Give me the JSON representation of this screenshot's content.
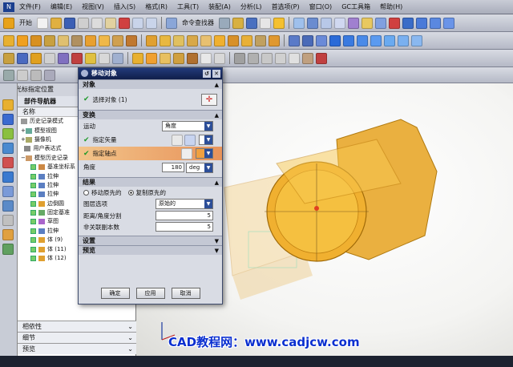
{
  "menubar": {
    "items": [
      "文件(F)",
      "编辑(E)",
      "视图(V)",
      "插入(S)",
      "格式(R)",
      "工具(T)",
      "装配(A)",
      "分析(L)",
      "首选项(P)",
      "窗口(O)",
      "GC工具箱",
      "帮助(H)"
    ]
  },
  "toolbar1": {
    "start_label": "开始",
    "command_finder_label": "命令查找器"
  },
  "status_hint": "使用光标指定位置",
  "navigator": {
    "title": "部件导航器",
    "column_header": "名称",
    "rows": [
      "历史记录模式",
      "模型视图",
      "摄像机",
      "用户表达式",
      "模型历史记录",
      "基准坐标系",
      "拉伸",
      "拉伸",
      "拉伸",
      "边倒圆",
      "固定基准",
      "草图",
      "拉伸",
      "体 (9)",
      "体 (11)",
      "体 (12)"
    ],
    "bottom_sections": [
      "相依性",
      "细节",
      "预览"
    ]
  },
  "dialog": {
    "title": "移动对象",
    "sections": {
      "object": "对象",
      "transform": "变换",
      "result": "结果",
      "settings": "设置",
      "preview": "预览"
    },
    "select_object_label": "选择对象 (1)",
    "motion_label": "运动",
    "motion_value": "角度",
    "vector_label": "指定矢量",
    "axis_point_label": "指定轴点",
    "angle_label": "角度",
    "angle_value": "180",
    "angle_unit": "deg",
    "move_original_label": "移动原先的",
    "copy_original_label": "复制原先的",
    "layer_option_label": "图层选项",
    "layer_option_value": "原始的",
    "distance_divisions_label": "距离/角度分割",
    "distance_divisions_value": "5",
    "copies_label": "非关联副本数",
    "copies_value": "5",
    "ok_label": "确定",
    "apply_label": "应用",
    "cancel_label": "取消"
  },
  "watermark": "CAD教程网：www.cadjcw.com"
}
